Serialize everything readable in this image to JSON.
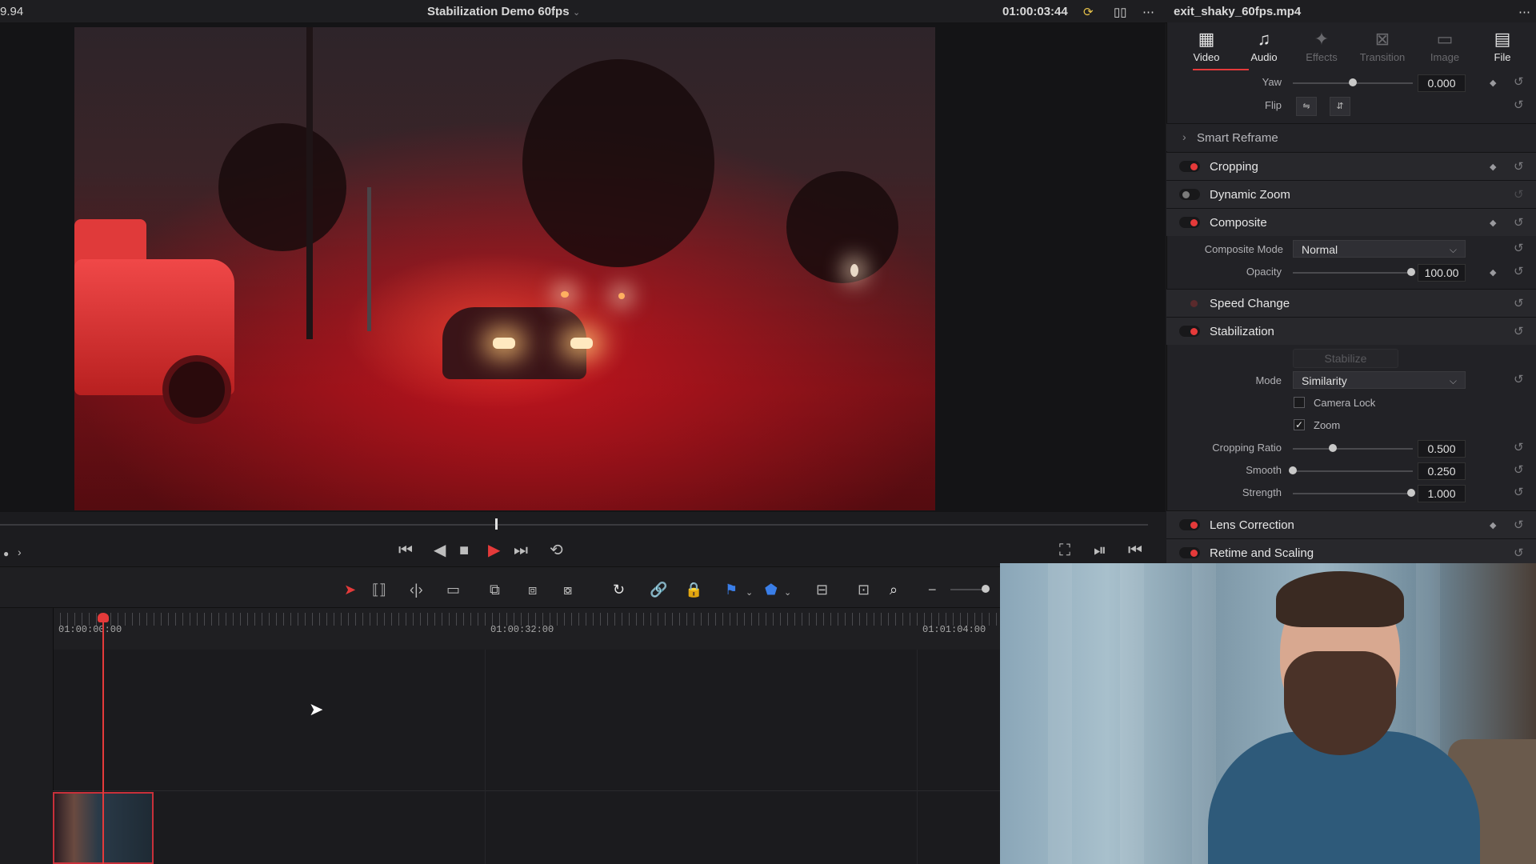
{
  "topbar": {
    "fps_fragment": "9.94",
    "project_title": "Stabilization Demo 60fps",
    "timecode": "01:00:03:44",
    "clip_name": "exit_shaky_60fps.mp4"
  },
  "inspector": {
    "tabs": [
      {
        "label": "Video",
        "icon": "film-icon"
      },
      {
        "label": "Audio",
        "icon": "music-note-icon"
      },
      {
        "label": "Effects",
        "icon": "magic-wand-icon"
      },
      {
        "label": "Transition",
        "icon": "transition-icon"
      },
      {
        "label": "Image",
        "icon": "image-icon"
      },
      {
        "label": "File",
        "icon": "file-icon"
      }
    ],
    "yaw": {
      "label": "Yaw",
      "value": "0.000"
    },
    "flip": {
      "label": "Flip"
    },
    "smart_reframe": "Smart Reframe",
    "sections": {
      "cropping": "Cropping",
      "dynamic_zoom": "Dynamic Zoom",
      "composite": "Composite",
      "speed_change": "Speed Change",
      "stabilization": "Stabilization",
      "lens_correction": "Lens Correction",
      "retime_scaling": "Retime and Scaling"
    },
    "composite": {
      "mode_label": "Composite Mode",
      "mode_value": "Normal",
      "opacity_label": "Opacity",
      "opacity_value": "100.00"
    },
    "stabilization": {
      "stabilize_button": "Stabilize",
      "mode_label": "Mode",
      "mode_value": "Similarity",
      "camera_lock_label": "Camera Lock",
      "camera_lock_checked": false,
      "zoom_label": "Zoom",
      "zoom_checked": true,
      "cropping_ratio_label": "Cropping Ratio",
      "cropping_ratio_value": "0.500",
      "smooth_label": "Smooth",
      "smooth_value": "0.250",
      "strength_label": "Strength",
      "strength_value": "1.000"
    }
  },
  "timeline": {
    "ruler_timecodes": [
      "01:00:00:00",
      "01:00:32:00",
      "01:01:04:00"
    ]
  },
  "colors": {
    "accent_red": "#e43a3a",
    "panel_bg": "#222226",
    "viewer_bg": "#141416"
  }
}
